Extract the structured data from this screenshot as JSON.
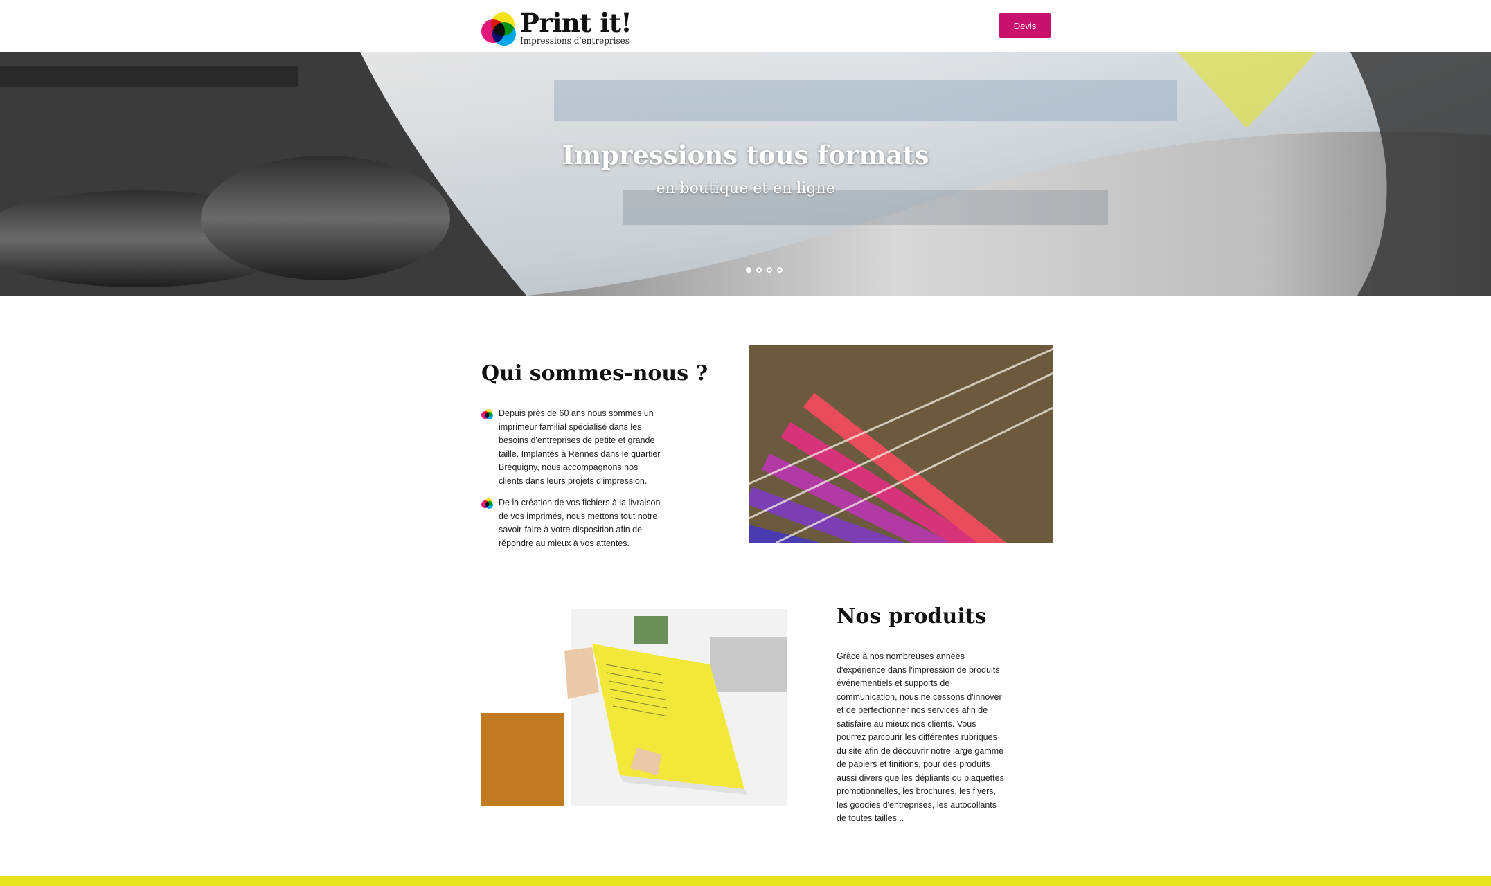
{
  "header": {
    "logo_title": "Print it!",
    "logo_subtitle": "Impressions d'entreprises",
    "devis_label": "Devis"
  },
  "hero": {
    "title": "Impressions tous formats",
    "subtitle": "en boutique et en ligne",
    "slides": 4,
    "active_slide": 1
  },
  "about": {
    "title": "Qui sommes-nous ?",
    "items": [
      "Depuis près de 60 ans nous sommes un imprimeur familial spécialisé dans les besoins d'entreprises de petite et grande taille. Implantés à Rennes dans le quartier Bréquigny, nous accompagnons nos clients dans leurs projets d'impression.",
      "De la création de vos fichiers à la livraison de vos imprimés, nous mettons tout notre savoir-faire à votre disposition afin de répondre au mieux à vos attentes."
    ]
  },
  "products": {
    "title": "Nos produits",
    "text": "Grâce à nos nombreuses années d'expérience dans l'impression de produits événementiels et supports de communication, nous ne cessons d'innover et de perfectionner nos services afin de satisfaire au mieux nos clients. Vous pourrez parcourir les différentes rubriques du site afin de découvrir notre large gamme de papiers et finitions, pour des produits aussi divers que les dépliants ou plaquettes promotionnelles, les brochures, les flyers, les goodies d'entreprises, les autocollants de toutes tailles..."
  },
  "colors": {
    "brand": "#c8116d",
    "footer": "#e6e31e",
    "logo_cyan": "#00a6e6",
    "logo_magenta": "#e0187a",
    "logo_yellow": "#f5e21a"
  }
}
